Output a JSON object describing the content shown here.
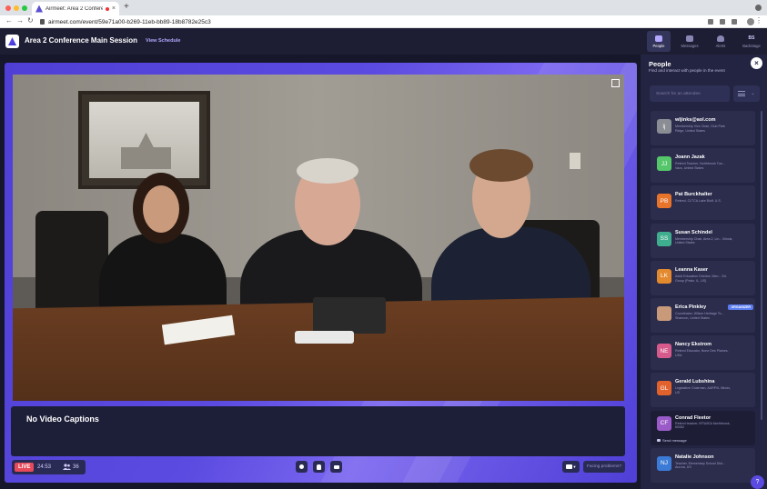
{
  "browser": {
    "tab_title": "Airmeet: Area 2 Conferen",
    "tab_close": "×",
    "new_tab": "+",
    "url": "airmeet.com/event/59e71a00-b269-11eb-bb89-18b8782e25c3"
  },
  "header": {
    "event_title": "Area 2 Conference Main Session",
    "view_schedule": "View Schedule"
  },
  "stage": {
    "captions": "No Video Captions",
    "live_label": "LIVE",
    "timer": "24:53",
    "attendee_count": "36",
    "problem_button": "Facing problems?"
  },
  "right_nav": {
    "tabs": [
      {
        "label": "People",
        "icon": "people-icon"
      },
      {
        "label": "Messages",
        "icon": "chat-icon"
      },
      {
        "label": "Alerts",
        "icon": "bell-icon"
      },
      {
        "label": "Backstage",
        "icon": "BS"
      }
    ]
  },
  "panel": {
    "title": "People",
    "subtitle": "Find and interact with people in the event",
    "close": "×",
    "search_placeholder": "Search for an attendee",
    "people": [
      {
        "initials": "lj",
        "name": "wljinks@aol.com",
        "detail": "Membership Vice Chair, Club Park Ridge, United States",
        "color": "#8a8d93"
      },
      {
        "initials": "JJ",
        "name": "Joann Jazak",
        "detail": "Retired Teacher, Northbrook Toa... Vacs, United States",
        "color": "#55c66a"
      },
      {
        "initials": "PB",
        "name": "Pat Burckhalter",
        "detail": "Retired, CLTCA Lake Bluff, U.S.",
        "color": "#e8732a"
      },
      {
        "initials": "SS",
        "name": "Susan Schindel",
        "detail": "Membership Chair, Area 2, Lin... Illinois, United States",
        "color": "#3fae8e"
      },
      {
        "initials": "LK",
        "name": "Leanna Kaser",
        "detail": "Adult Education Director, Men... Ed. Group (Pekin, IL, US)",
        "color": "#e38a2e"
      },
      {
        "initials": "EP",
        "name": "Erica Pinkley",
        "detail": "Coordinator, Wilson Heritage To... Shannon, United States",
        "color": "#c89a7a"
      },
      {
        "initials": "NE",
        "name": "Nancy Ekstrom",
        "detail": "Retired Educator, None Des Plaines, USA",
        "color": "#d65a8c"
      },
      {
        "initials": "GL",
        "name": "Gerald Lubshina",
        "detail": "Legislative Chairman, AARP/IL Illinois, US",
        "color": "#e2622e"
      },
      {
        "initials": "CF",
        "name": "Conrad Fleetor",
        "detail": "Retired teacher, IRTA/IEA Northbrook, 60062",
        "color": "#9a5ac8"
      },
      {
        "initials": "NJ",
        "name": "Natalie Johnson",
        "detail": "Teacher, Elementary School Dist... Aurora, US",
        "color": "#3b7bd6"
      }
    ],
    "organizer_badge": "ORGANIZER",
    "send_message": "Send message"
  },
  "help": "?"
}
